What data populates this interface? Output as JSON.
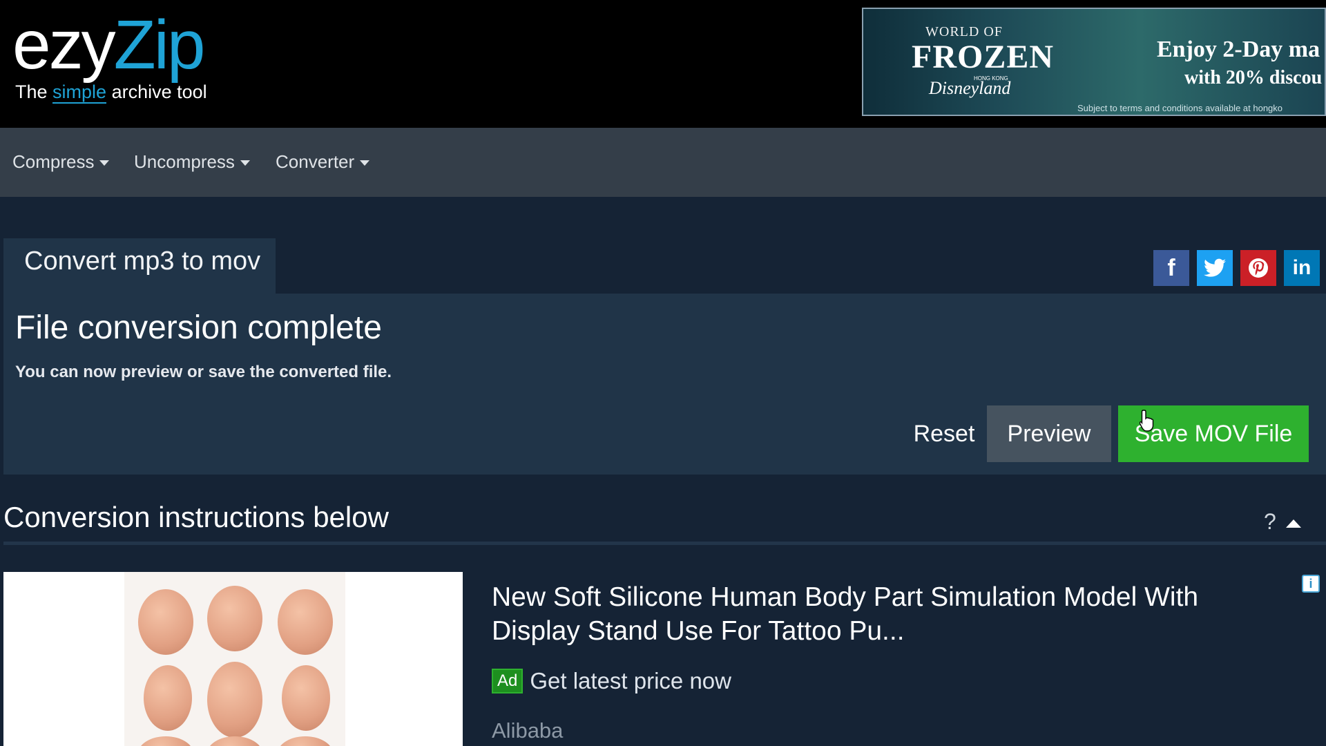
{
  "logo": {
    "ezy": "ezy",
    "zip": "Zip",
    "tag_pre": "The ",
    "tag_simple": "simple",
    "tag_post": " archive tool"
  },
  "banner": {
    "world_of": "WORLD OF",
    "frozen": "FROZEN",
    "disneyland": "Disneyland",
    "hong_kong": "HONG KONG",
    "headline": "Enjoy 2-Day ma",
    "discount": "with 20% discou",
    "terms": "Subject to terms and conditions available at hongko"
  },
  "nav": {
    "items": [
      {
        "label": "Compress"
      },
      {
        "label": "Uncompress"
      },
      {
        "label": "Converter"
      }
    ]
  },
  "tab": {
    "label": "Convert mp3 to mov"
  },
  "panel": {
    "title": "File conversion complete",
    "subtitle": "You can now preview or save the converted file.",
    "reset_label": "Reset",
    "preview_label": "Preview",
    "save_label": "Save MOV File"
  },
  "social": {
    "facebook": "f",
    "linkedin": "in",
    "icons": [
      "facebook-icon",
      "twitter-icon",
      "pinterest-icon",
      "linkedin-icon"
    ]
  },
  "instructions": {
    "heading": "Conversion instructions below",
    "help": "?"
  },
  "ad": {
    "title": "New Soft Silicone Human Body Part Simulation Model With Display Stand Use For Tattoo Pu...",
    "badge": "Ad",
    "cta": "Get latest price now",
    "brand": "Alibaba",
    "info": "i"
  },
  "colors": {
    "accent": "#1fa3d6",
    "save": "#2eb12f",
    "panel": "#203448",
    "page": "#152335",
    "nav": "#343e49"
  }
}
